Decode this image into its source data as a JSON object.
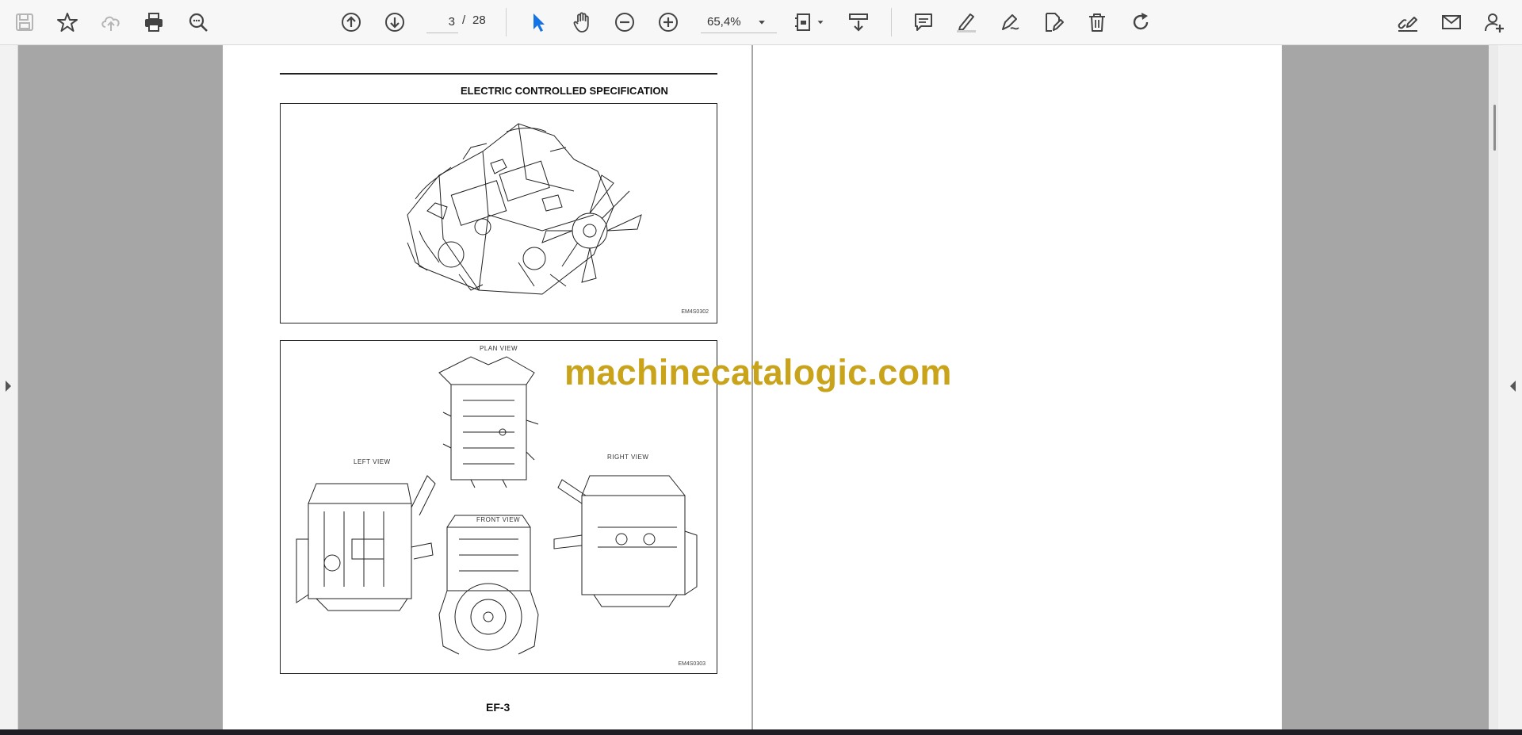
{
  "toolbar": {
    "buttons": {
      "save": "save-icon",
      "bookmark": "star-icon",
      "upload": "cloud-upload-icon",
      "print": "print-icon",
      "find": "find-icon",
      "prev_page": "arrow-up-icon",
      "next_page": "arrow-down-icon",
      "zoom_out": "minus-icon",
      "zoom_in": "plus-icon",
      "select": "cursor-icon",
      "hand": "hand-icon",
      "fit": "fit-page-icon",
      "scroll_mode": "scroll-mode-icon",
      "comment": "comment-icon",
      "highlight": "highlight-icon",
      "draw": "pen-icon",
      "edit_pdf": "edit-icon",
      "delete": "trash-icon",
      "rotate": "rotate-icon",
      "share_link": "link-pen-icon",
      "email": "mail-icon",
      "add_user": "add-user-icon"
    },
    "page_current": "3",
    "page_separator": "/",
    "page_total": "28",
    "zoom_value": "65,4%"
  },
  "document": {
    "header_title": "ELECTRIC CONTROLLED SPECIFICATION",
    "figure1_code": "EM4S0302",
    "figure2_code": "EM4S0303",
    "labels": {
      "plan": "PLAN VIEW",
      "left": "LEFT VIEW",
      "right": "RIGHT VIEW",
      "front": "FRONT VIEW"
    },
    "page_number": "EF-3"
  },
  "watermark": "machinecatalogic.com",
  "colors": {
    "accent": "#1473e6",
    "watermark": "#c9a31a",
    "background": "#a6a6a6"
  }
}
